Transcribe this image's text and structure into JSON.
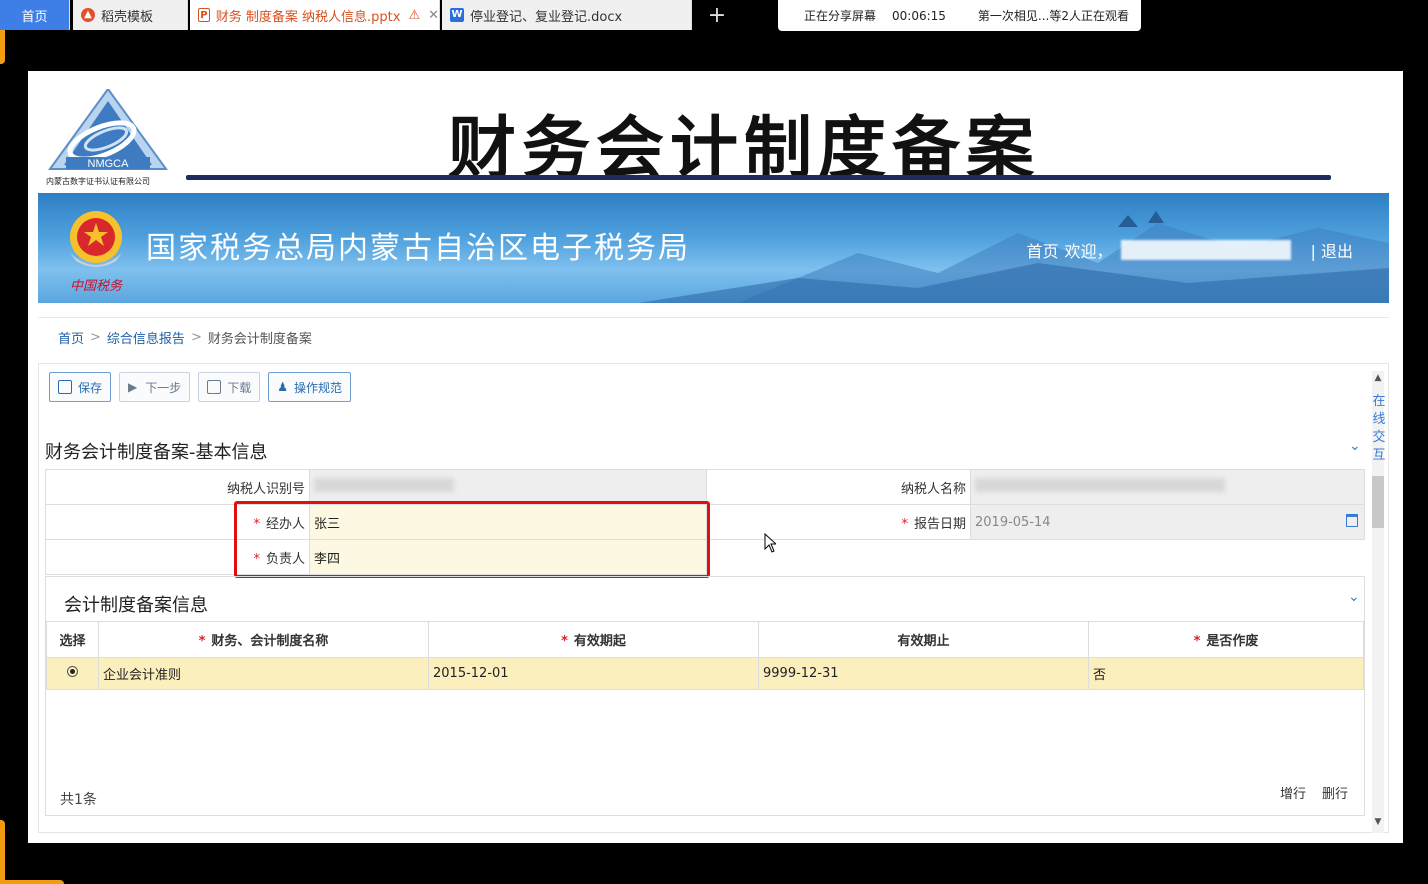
{
  "tabs": [
    {
      "label": "首页"
    },
    {
      "label": "稻壳模板"
    },
    {
      "label": "财务 制度备案 纳税人信息.pptx"
    },
    {
      "label": "停业登记、复业登记.docx"
    }
  ],
  "share": {
    "status": "正在分享屏幕",
    "timer": "00:06:15",
    "viewers": "第一次相见...等2人正在观看"
  },
  "slide": {
    "logo_text": "NMGCA",
    "logo_caption": "内蒙古数字证书认证有限公司",
    "main_title": "财务会计制度备案",
    "banner_title": "国家税务总局内蒙古自治区电子税务局",
    "emblem_caption": "中国税务",
    "nav_home": "首页",
    "nav_welcome": "欢迎，",
    "nav_logout": "| 退出"
  },
  "breadcrumb": {
    "home": "首页",
    "report": "综合信息报告",
    "current": "财务会计制度备案"
  },
  "toolbar": {
    "save": "保存",
    "next": "下一步",
    "download": "下载",
    "guide": "操作规范"
  },
  "basic": {
    "title": "财务会计制度备案-基本信息",
    "taxpayer_id_label": "纳税人识别号",
    "taxpayer_name_label": "纳税人名称",
    "handler_label": "经办人",
    "handler_value": "张三",
    "report_date_label": "报告日期",
    "report_date_value": "2019-05-14",
    "responsible_label": "负责人",
    "responsible_value": "李四"
  },
  "records": {
    "title": "会计制度备案信息",
    "columns": [
      "选择",
      "财务、会计制度名称",
      "有效期起",
      "有效期止",
      "是否作废"
    ],
    "rows": [
      {
        "name": "企业会计准则",
        "start": "2015-12-01",
        "end": "9999-12-31",
        "void": "否"
      }
    ],
    "total": "共1条",
    "add_row": "增行",
    "delete_row": "删行"
  },
  "side_tab": {
    "label": "在线交互"
  },
  "colors": {
    "accent": "#3d7fe6",
    "required": "#e02020",
    "highlight": "#fbefbe",
    "banner": "#4ea0dd"
  }
}
